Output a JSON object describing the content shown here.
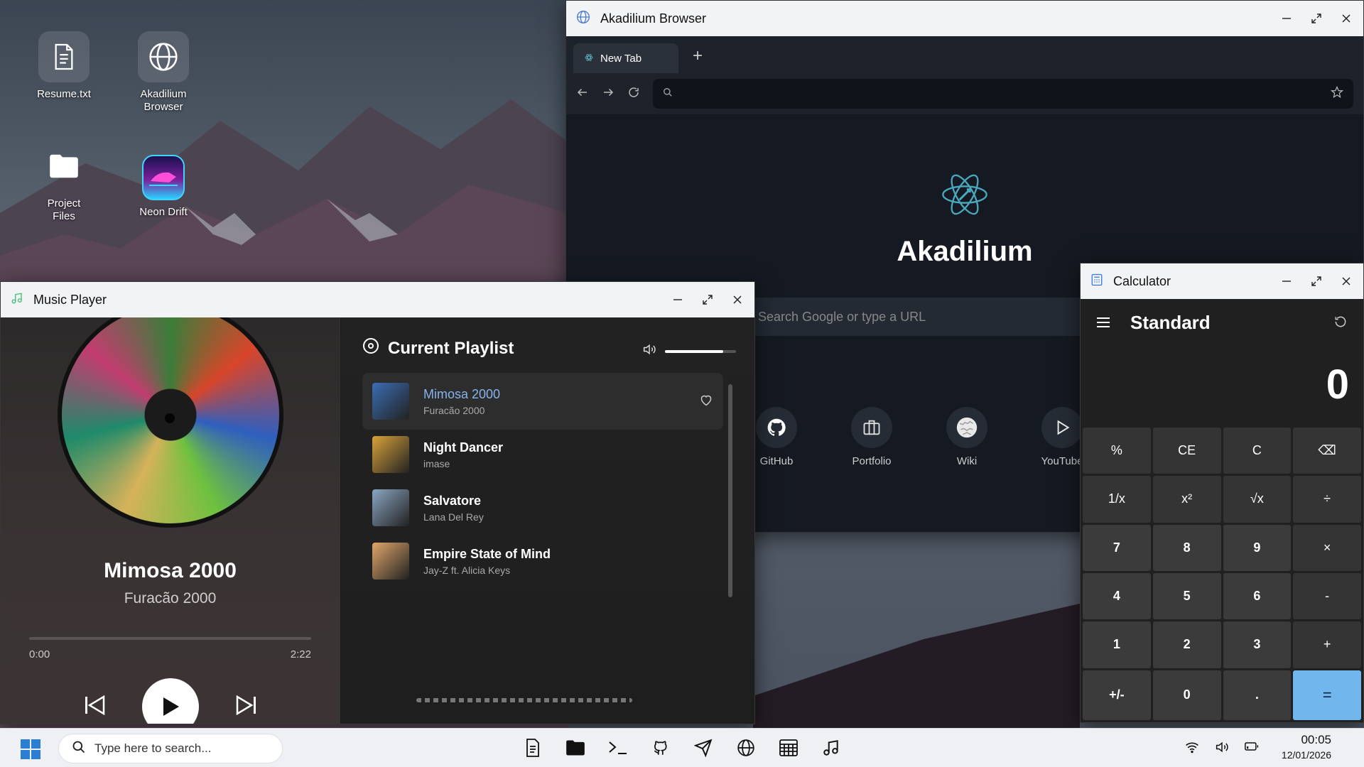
{
  "desktop": {
    "icons": [
      {
        "label": "Resume.txt",
        "icon": "document-icon"
      },
      {
        "label": "Akadilium Browser",
        "icon": "globe-icon"
      },
      {
        "label": "Project Files",
        "icon": "folder-icon"
      },
      {
        "label": "Neon Drift",
        "icon": "game-icon"
      }
    ]
  },
  "browser": {
    "title": "Akadilium Browser",
    "tab_label": "New Tab",
    "omnibox_placeholder": "",
    "brand": "Akadilium",
    "search_placeholder": "Search Google or type a URL",
    "shortcuts": [
      {
        "label": "GitHub",
        "icon": "github-icon"
      },
      {
        "label": "Portfolio",
        "icon": "briefcase-icon"
      },
      {
        "label": "Wiki",
        "icon": "wikipedia-icon"
      },
      {
        "label": "YouTube",
        "icon": "play-icon"
      }
    ]
  },
  "calculator": {
    "title": "Calculator",
    "mode": "Standard",
    "display": "0",
    "keys": [
      [
        "%",
        "CE",
        "C",
        "⌫"
      ],
      [
        "1/x",
        "x²",
        "√x",
        "÷"
      ],
      [
        "7",
        "8",
        "9",
        "×"
      ],
      [
        "4",
        "5",
        "6",
        "-"
      ],
      [
        "1",
        "2",
        "3",
        "+"
      ],
      [
        "+/-",
        "0",
        ".",
        "="
      ]
    ],
    "accent": "#72b6ee"
  },
  "music": {
    "title": "Music Player",
    "now_playing": {
      "title": "Mimosa 2000",
      "artist": "Furacão 2000",
      "elapsed": "0:00",
      "duration": "2:22",
      "progress": 0
    },
    "playlist_title": "Current Playlist",
    "volume": 0.82,
    "tracks": [
      {
        "title": "Mimosa 2000",
        "artist": "Furacão 2000",
        "active": true,
        "cover_color": "#3b6db3"
      },
      {
        "title": "Night Dancer",
        "artist": "imase",
        "active": false,
        "cover_color": "#d9a23a"
      },
      {
        "title": "Salvatore",
        "artist": "Lana Del Rey",
        "active": false,
        "cover_color": "#8aa6c2"
      },
      {
        "title": "Empire State of Mind",
        "artist": "Jay-Z ft. Alicia Keys",
        "active": false,
        "cover_color": "#e0a66a"
      }
    ]
  },
  "taskbar": {
    "search_placeholder": "Type here to search...",
    "apps": [
      "notepad-icon",
      "folder-icon",
      "terminal-icon",
      "github-icon",
      "send-icon",
      "globe-icon",
      "calculator-icon",
      "music-icon"
    ],
    "time": "00:05",
    "date": "12/01/2026"
  }
}
